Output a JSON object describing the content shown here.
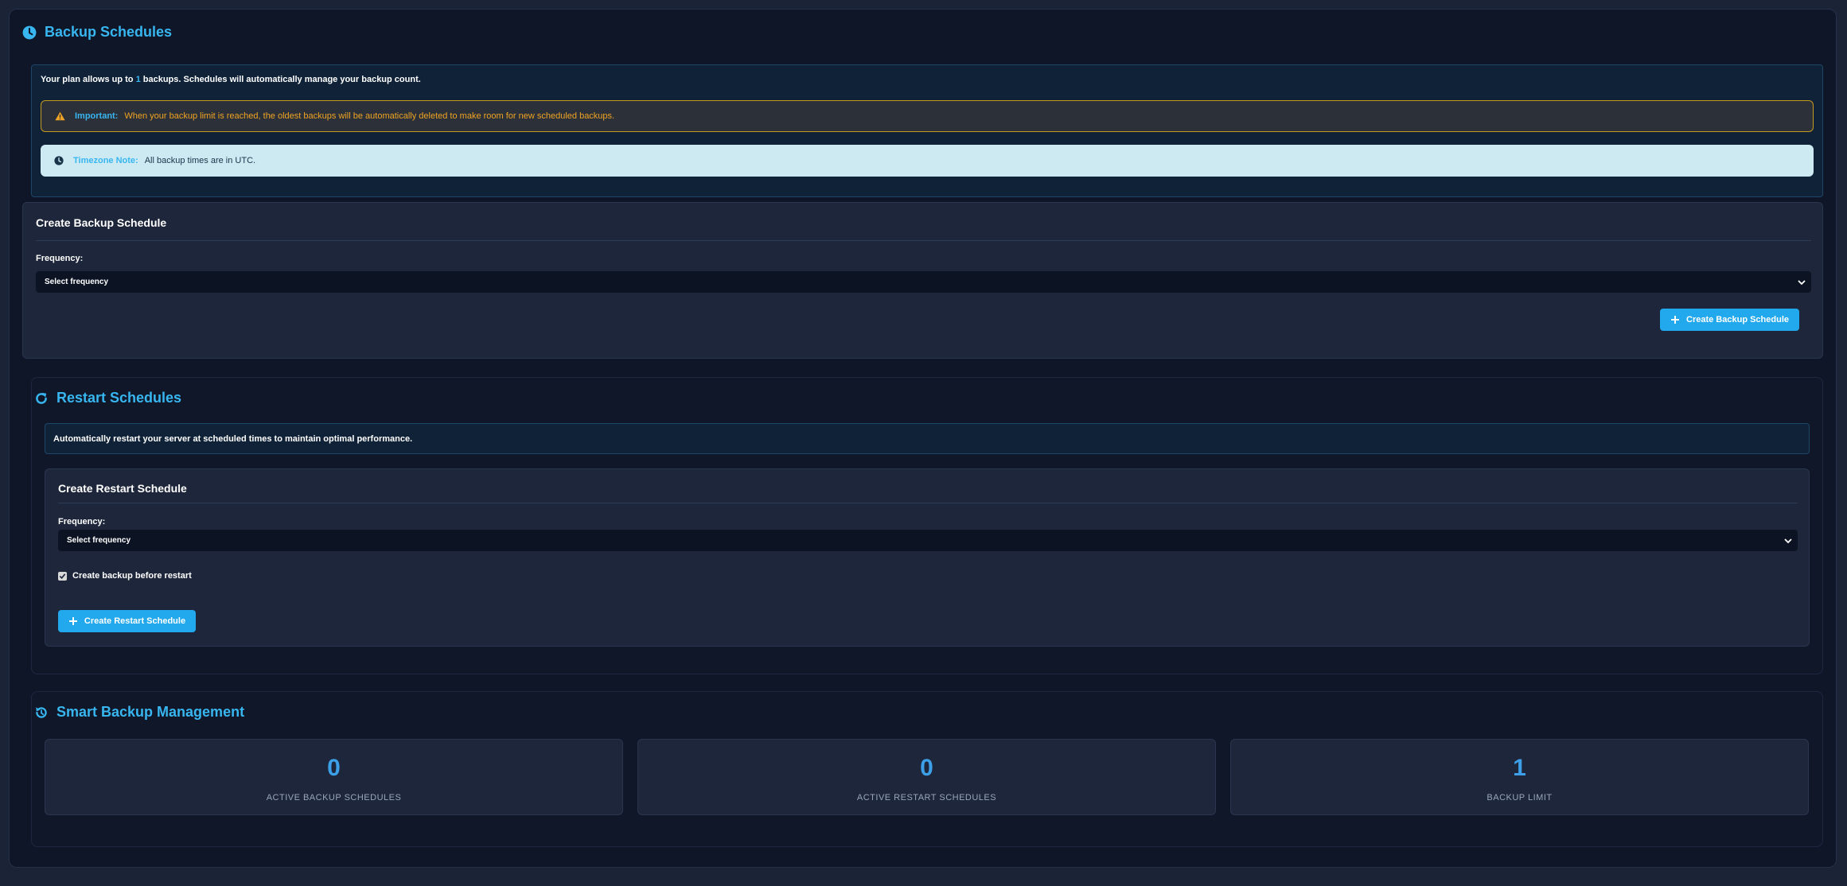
{
  "backup": {
    "title": "Backup Schedules",
    "plan_prefix": "Your plan allows up to ",
    "plan_limit": "1",
    "plan_suffix": " backups. Schedules will automatically manage your backup count.",
    "warning_label": "Important:",
    "warning_text": "When your backup limit is reached, the oldest backups will be automatically deleted to make room for new scheduled backups.",
    "tz_label": "Timezone Note:",
    "tz_text": "All backup times are in UTC.",
    "create_card": {
      "title": "Create Backup Schedule",
      "frequency_label": "Frequency:",
      "frequency_value": "Select frequency",
      "button_label": "Create Backup Schedule"
    }
  },
  "restart": {
    "title": "Restart Schedules",
    "info_text": "Automatically restart your server at scheduled times to maintain optimal performance.",
    "create_card": {
      "title": "Create Restart Schedule",
      "frequency_label": "Frequency:",
      "frequency_value": "Select frequency",
      "checkbox_label": "Create backup before restart",
      "checkbox_checked": true,
      "button_label": "Create Restart Schedule"
    }
  },
  "smart": {
    "title": "Smart Backup Management",
    "stats": [
      {
        "value": "0",
        "label": "ACTIVE BACKUP SCHEDULES"
      },
      {
        "value": "0",
        "label": "ACTIVE RESTART SCHEDULES"
      },
      {
        "value": "1",
        "label": "BACKUP LIMIT"
      }
    ]
  },
  "colors": {
    "accent": "#38b6f0",
    "button": "#22a8ec",
    "warning": "#f0a422",
    "stat_value": "#3d9fe8"
  }
}
